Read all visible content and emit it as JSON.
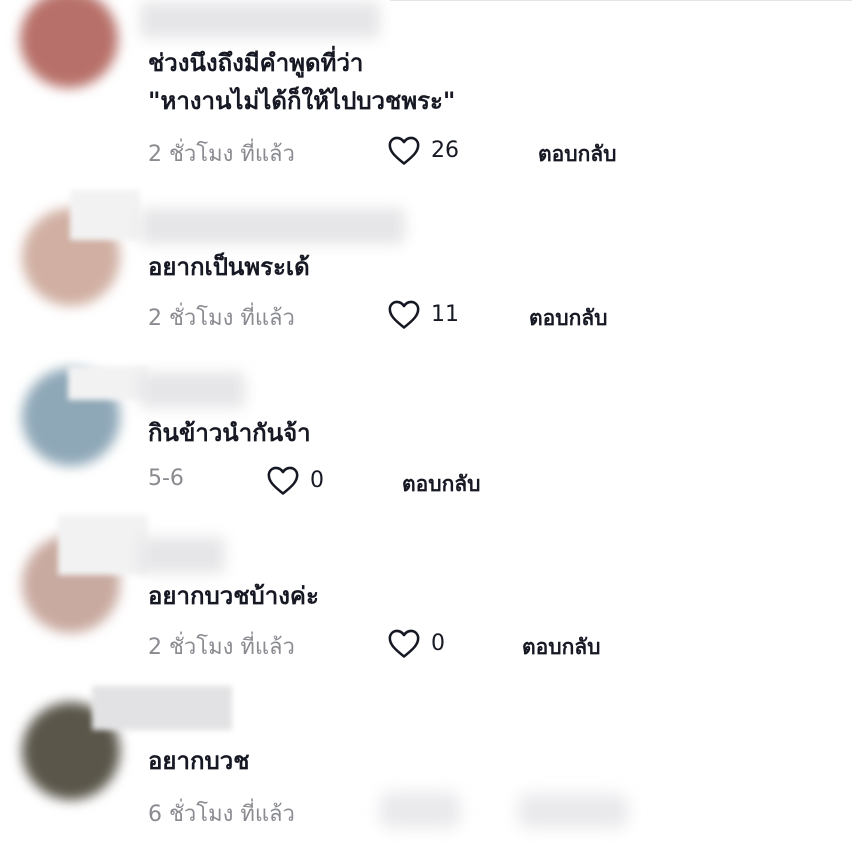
{
  "comments": [
    {
      "text_lines": [
        "ช่วงนึงถึงมีคำพูดที่ว่า",
        "\"หางานไม่ได้ก็ให้ไปบวชพระ\""
      ],
      "time": "2 ชั่วโมง ที่แล้ว",
      "likes": "26",
      "reply": "ตอบกลับ",
      "avatar_color": "#b8716a"
    },
    {
      "text_lines": [
        "อยากเป็นพระเด้"
      ],
      "time": "2 ชั่วโมง ที่แล้ว",
      "likes": "11",
      "reply": "ตอบกลับ",
      "avatar_color": "#d1b0a3"
    },
    {
      "text_lines": [
        "กินข้าวนำกันจ้า"
      ],
      "time": "5-6",
      "likes": "0",
      "reply": "ตอบกลับ",
      "avatar_color": "#8fa8b8"
    },
    {
      "text_lines": [
        "อยากบวชบ้างค่ะ"
      ],
      "time": "2 ชั่วโมง ที่แล้ว",
      "likes": "0",
      "reply": "ตอบกลับ",
      "avatar_color": "#c9aaa0"
    },
    {
      "text_lines": [
        "อยากบวช"
      ],
      "time": "6 ชั่วโมง ที่แล้ว",
      "likes": "",
      "reply": "",
      "avatar_color": "#5a564a"
    }
  ],
  "icons": {
    "like": "heart-outline-icon"
  }
}
